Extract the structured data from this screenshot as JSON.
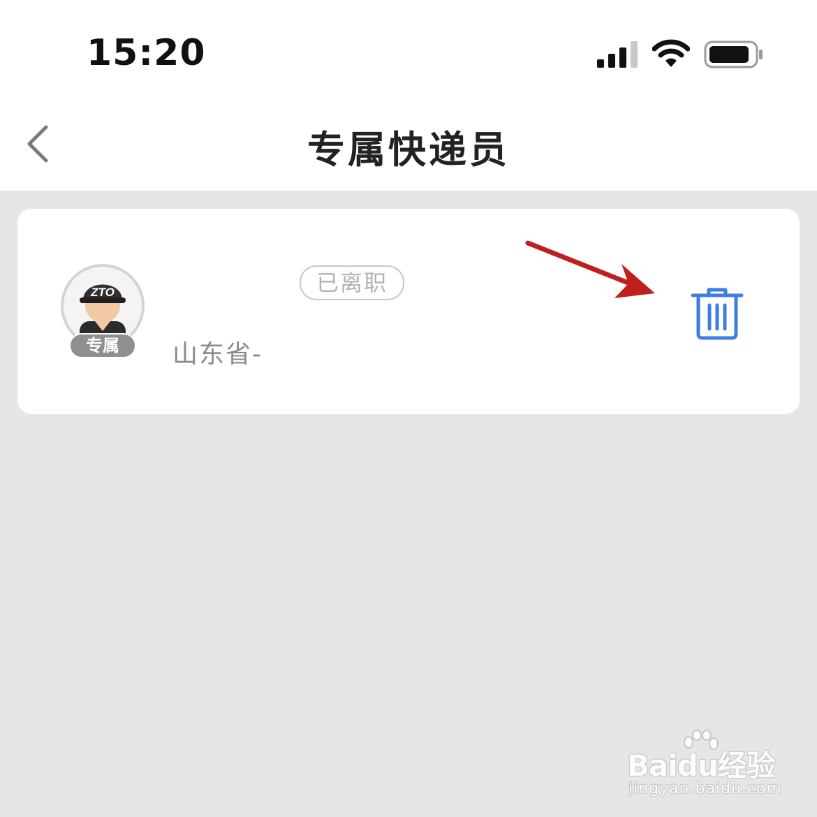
{
  "status_bar": {
    "time": "15:20",
    "signal_icon": "cellular-signal-icon",
    "wifi_icon": "wifi-icon",
    "battery_icon": "battery-icon"
  },
  "nav": {
    "back_icon": "chevron-left-icon",
    "title": "专属快递员"
  },
  "courier_card": {
    "avatar_badge": "专属",
    "cap_logo": "ZTO",
    "status_tag": "已离职",
    "address": "山东省-",
    "delete_icon": "trash-icon",
    "annotation_arrow_color": "#c0201d",
    "delete_icon_color": "#3d7fe0"
  },
  "watermark": {
    "brand": "Baidu经验",
    "url": "jingyan.baidu.com"
  },
  "colors": {
    "page_background": "#e6e6e6",
    "card_background": "#ffffff",
    "title_text": "#222222"
  }
}
